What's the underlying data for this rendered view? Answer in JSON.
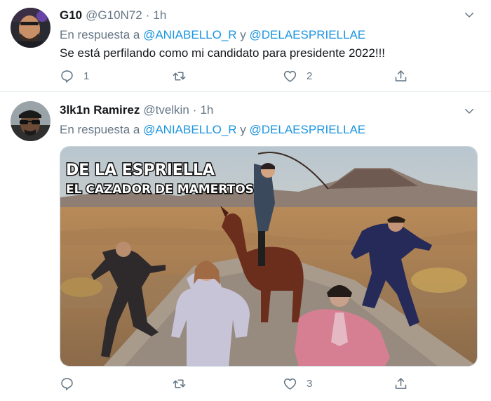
{
  "tweets": [
    {
      "name": "G10",
      "handle": "@G10N72",
      "separator": "·",
      "time": "1h",
      "reply_prefix": "En respuesta a ",
      "reply_mention_1": "@ANIABELLO_R",
      "reply_joiner": " y ",
      "reply_mention_2": "@DELAESPRIELLAE",
      "text": "Se está perfilando como mi candidato para presidente 2022!!!",
      "reply_count": "1",
      "retweet_count": "",
      "like_count": "2"
    },
    {
      "name": "3lk1n Ramirez",
      "handle": "@tvelkin",
      "separator": "·",
      "time": "1h",
      "reply_prefix": "En respuesta a ",
      "reply_mention_1": "@ANIABELLO_R",
      "reply_joiner": " y ",
      "reply_mention_2": "@DELAESPRIELLAE",
      "media_caption_1": "DE LA ESPRIELLA",
      "media_caption_2": "EL CAZADOR DE MAMERTOS",
      "reply_count": "",
      "retweet_count": "",
      "like_count": "3"
    }
  ],
  "icons": {
    "reply": "reply-icon",
    "retweet": "retweet-icon",
    "like": "like-icon",
    "share": "share-icon",
    "caret": "chevron-down-icon"
  },
  "colors": {
    "accent": "#1b95e0",
    "secondary_text": "#657786",
    "primary_text": "#14171a",
    "divider": "#e6ecf0"
  }
}
